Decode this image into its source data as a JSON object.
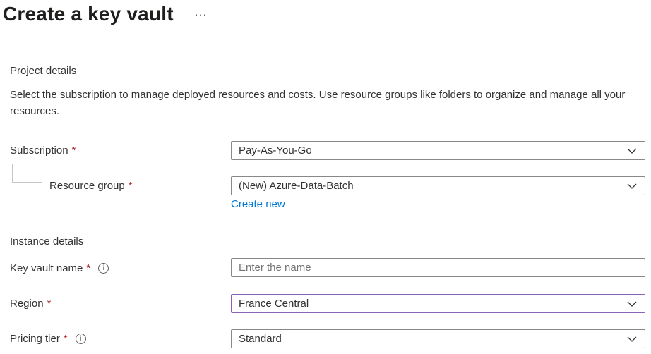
{
  "header": {
    "title": "Create a key vault",
    "more_label": "···"
  },
  "project": {
    "heading": "Project details",
    "description": "Select the subscription to manage deployed resources and costs. Use resource groups like folders to organize and manage all your resources."
  },
  "fields": {
    "subscription": {
      "label": "Subscription",
      "required": "*",
      "value": "Pay-As-You-Go"
    },
    "resource_group": {
      "label": "Resource group",
      "required": "*",
      "value": "(New) Azure-Data-Batch",
      "create_new": "Create new"
    },
    "key_vault_name": {
      "label": "Key vault name",
      "required": "*",
      "info": "i",
      "placeholder": "Enter the name",
      "value": ""
    },
    "region": {
      "label": "Region",
      "required": "*",
      "value": "France Central"
    },
    "pricing_tier": {
      "label": "Pricing tier",
      "required": "*",
      "info": "i",
      "value": "Standard"
    }
  },
  "instance": {
    "heading": "Instance details"
  },
  "colors": {
    "required": "#a4262c",
    "link": "#0078d4",
    "focus_border": "#8764b8"
  },
  "icons": {
    "dropdown": "chevron-down-icon",
    "info": "info-icon"
  }
}
